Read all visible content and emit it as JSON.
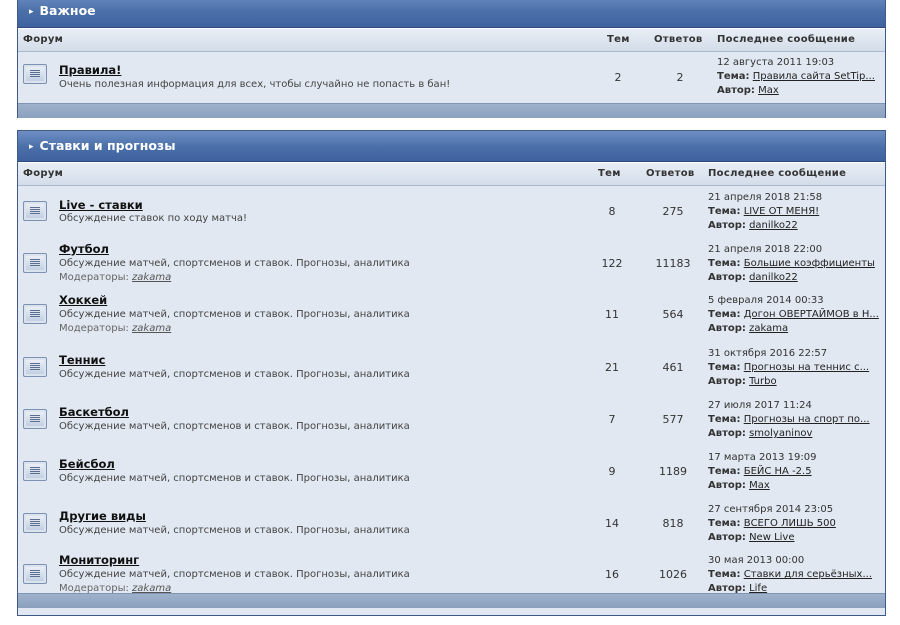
{
  "sections": [
    {
      "title": "Важное",
      "columns": {
        "forum": "Форум",
        "topics": "Тем",
        "replies": "Ответов",
        "last": "Последнее сообщение"
      },
      "forums": [
        {
          "title": "Правила!",
          "desc": "Очень полезная информация для всех, чтобы случайно не попасть в бан!",
          "topics": "2",
          "replies": "2",
          "last_date": "12 августа 2011 19:03",
          "last_topic_label": "Тема:",
          "last_topic": "Правила сайта SetTip...",
          "last_author_label": "Автор:",
          "last_author": "Max"
        }
      ]
    },
    {
      "title": "Ставки и прогнозы",
      "columns": {
        "forum": "Форум",
        "topics": "Тем",
        "replies": "Ответов",
        "last": "Последнее сообщение"
      },
      "forums": [
        {
          "title": "Live - ставки",
          "desc": "Обсуждение ставок по ходу матча!",
          "topics": "8",
          "replies": "275",
          "last_date": "21 апреля 2018 21:58",
          "last_topic_label": "Тема:",
          "last_topic": "LIVE ОТ МЕНЯ!",
          "last_author_label": "Автор:",
          "last_author": "danilko22"
        },
        {
          "title": "Футбол",
          "desc": "Обсуждение матчей, спортсменов и ставок. Прогнозы, аналитика",
          "mod_label": "Модераторы:",
          "mod": "zakama",
          "topics": "122",
          "replies": "11183",
          "last_date": "21 апреля 2018 22:00",
          "last_topic_label": "Тема:",
          "last_topic": "Большие коэффициенты",
          "last_author_label": "Автор:",
          "last_author": "danilko22"
        },
        {
          "title": "Хоккей",
          "desc": "Обсуждение матчей, спортсменов и ставок. Прогнозы, аналитика",
          "mod_label": "Модераторы:",
          "mod": "zakama",
          "topics": "11",
          "replies": "564",
          "last_date": "5 февраля 2014 00:33",
          "last_topic_label": "Тема:",
          "last_topic": "Догон ОВЕРТАЙМОВ в Н...",
          "last_author_label": "Автор:",
          "last_author": "zakama"
        },
        {
          "title": "Теннис",
          "desc": "Обсуждение матчей, спортсменов и ставок. Прогнозы, аналитика",
          "topics": "21",
          "replies": "461",
          "last_date": "31 октября 2016 22:57",
          "last_topic_label": "Тема:",
          "last_topic": "Прогнозы на теннис с...",
          "last_author_label": "Автор:",
          "last_author": "Turbo"
        },
        {
          "title": "Баскетбол",
          "desc": "Обсуждение матчей, спортсменов и ставок. Прогнозы, аналитика",
          "topics": "7",
          "replies": "577",
          "last_date": "27 июля 2017 11:24",
          "last_topic_label": "Тема:",
          "last_topic": "Прогнозы на спорт по...",
          "last_author_label": "Автор:",
          "last_author": "smolyaninov"
        },
        {
          "title": "Бейсбол",
          "desc": "Обсуждение матчей, спортсменов и ставок. Прогнозы, аналитика",
          "topics": "9",
          "replies": "1189",
          "last_date": "17 марта 2013 19:09",
          "last_topic_label": "Тема:",
          "last_topic": "БЕЙС НА -2.5",
          "last_author_label": "Автор:",
          "last_author": "Max"
        },
        {
          "title": "Другие виды",
          "desc": "Обсуждение матчей, спортсменов и ставок. Прогнозы, аналитика",
          "topics": "14",
          "replies": "818",
          "last_date": "27 сентября 2014 23:05",
          "last_topic_label": "Тема:",
          "last_topic": "ВСЕГО ЛИШЬ 500",
          "last_author_label": "Автор:",
          "last_author": "New Live"
        },
        {
          "title": "Мониторинг",
          "desc": "Обсуждение матчей, спортсменов и ставок. Прогнозы, аналитика",
          "mod_label": "Модераторы:",
          "mod": "zakama",
          "topics": "16",
          "replies": "1026",
          "last_date": "30 мая 2013 00:00",
          "last_topic_label": "Тема:",
          "last_topic": "Ставки для серьёзных...",
          "last_author_label": "Автор:",
          "last_author": "Life"
        }
      ]
    }
  ]
}
